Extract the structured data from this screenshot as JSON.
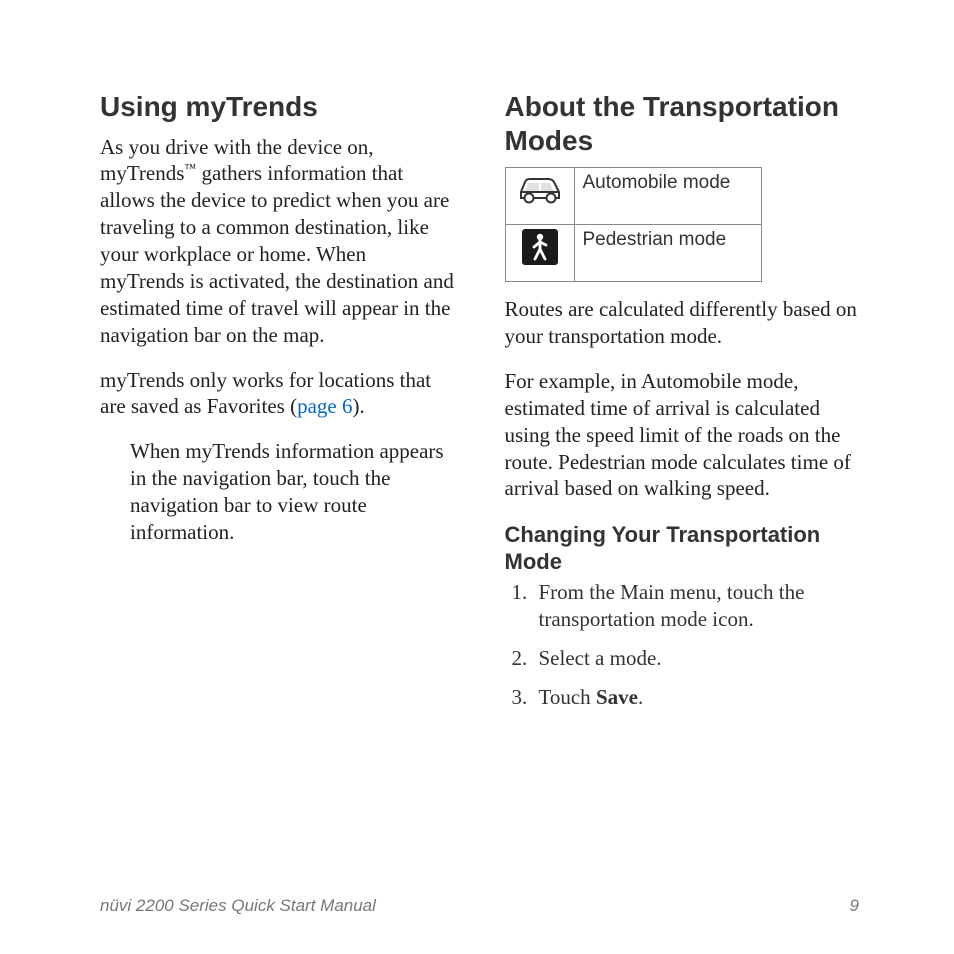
{
  "left": {
    "heading": "Using myTrends",
    "p1a": "As you drive with the device on, myTrends",
    "tm": "™",
    "p1b": " gathers information that allows the device to predict when you are traveling to a common destination, like your workplace or home. When myTrends is activated, the destination and estimated time of travel will appear in the navigation bar on the map.",
    "p2a": "myTrends only works for locations that are saved as Favorites (",
    "p2link": "page 6",
    "p2b": ").",
    "p3": "When myTrends information appears in the navigation bar, touch the navigation bar to view route information."
  },
  "right": {
    "heading": "About the Transportation Modes",
    "table": {
      "row1": {
        "label": "Automobile mode"
      },
      "row2": {
        "label": "Pedestrian mode"
      }
    },
    "p1": "Routes are calculated differently based on your transportation mode.",
    "p2": "For example, in Automobile mode, estimated time of arrival is calculated using the speed limit of the roads on the route. Pedestrian mode calculates time of arrival based on walking speed.",
    "sub_heading": "Changing Your Transportation Mode",
    "steps": {
      "s1": "From the Main menu, touch the transportation mode icon.",
      "s2": "Select a mode.",
      "s3a": "Touch ",
      "s3b": "Save",
      "s3c": "."
    }
  },
  "footer": {
    "left": "nüvi 2200 Series Quick Start Manual",
    "right": "9"
  }
}
